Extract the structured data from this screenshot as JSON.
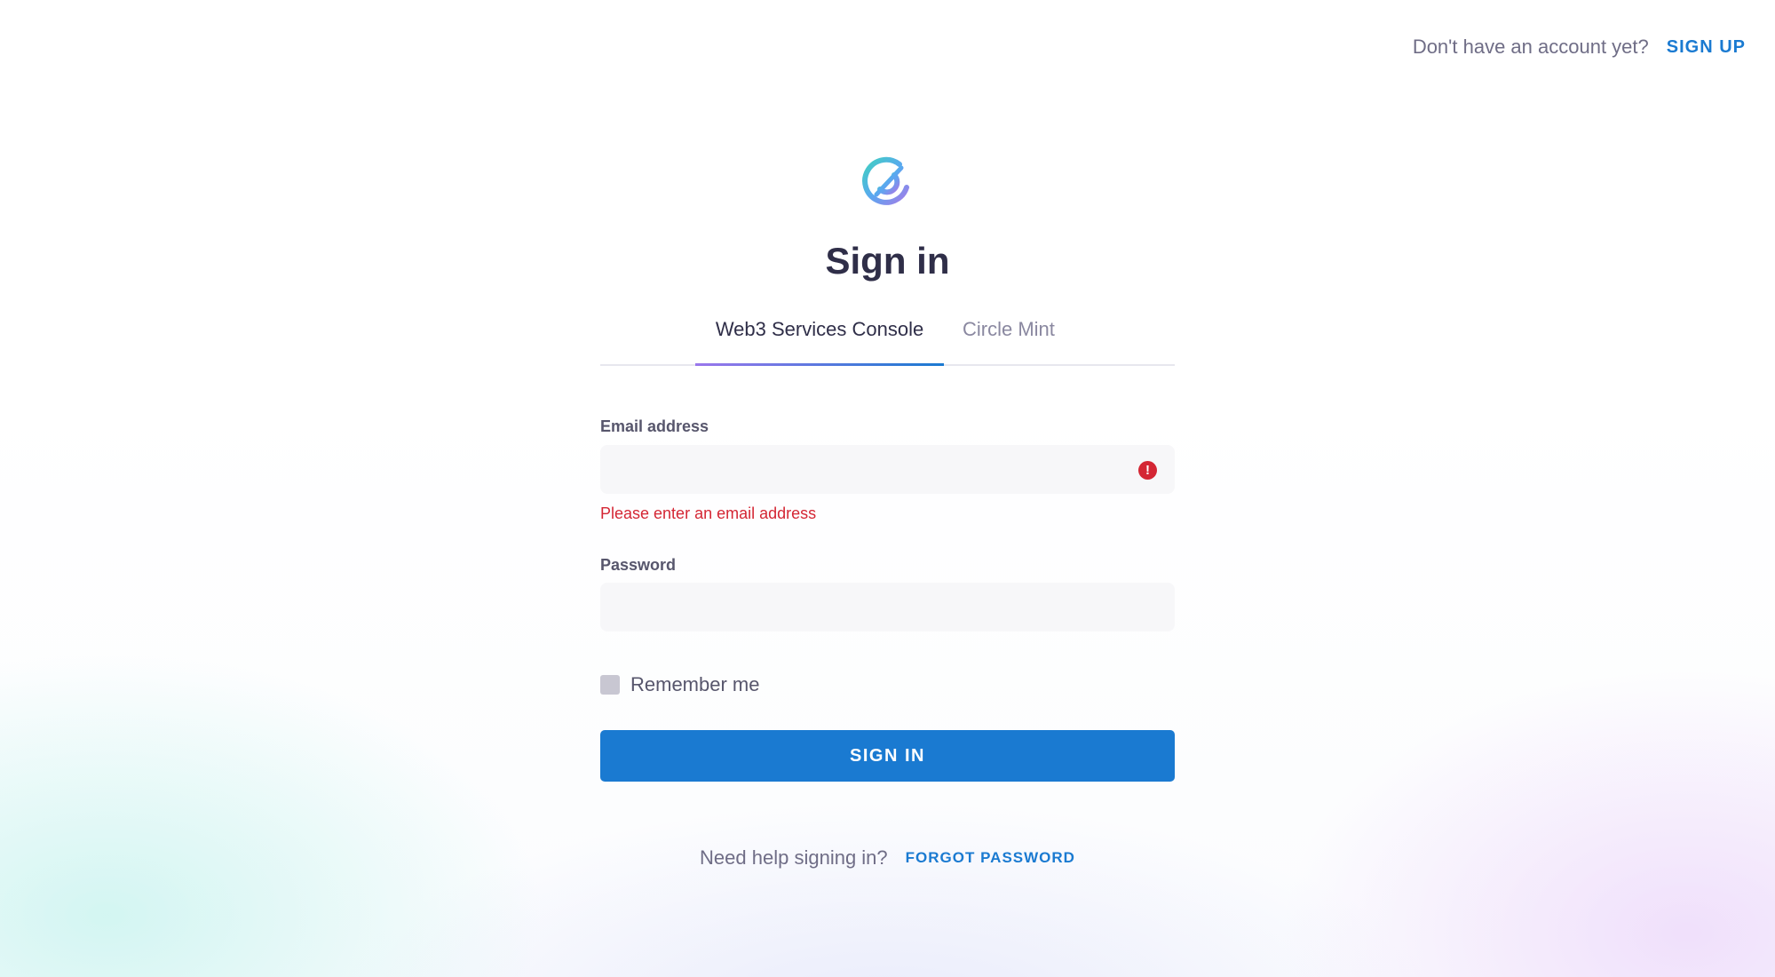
{
  "header": {
    "account_question": "Don't have an account yet?",
    "signup_label": "SIGN UP"
  },
  "logo": {
    "icon": "circle-logo-icon",
    "colors": [
      "#3fd0c0",
      "#5aa8f0",
      "#a27ce8"
    ]
  },
  "page_title": "Sign in",
  "tabs": [
    {
      "label": "Web3 Services Console",
      "active": true
    },
    {
      "label": "Circle Mint",
      "active": false
    }
  ],
  "form": {
    "email": {
      "label": "Email address",
      "value": "",
      "placeholder": "",
      "error": "Please enter an email address",
      "error_icon": "error-exclamation-icon"
    },
    "password": {
      "label": "Password",
      "value": "",
      "placeholder": ""
    },
    "remember_me": {
      "label": "Remember me",
      "checked": false
    },
    "submit_label": "SIGN IN"
  },
  "help": {
    "question": "Need help signing in?",
    "forgot_label": "FORGOT PASSWORD"
  },
  "colors": {
    "accent": "#1a7ad1",
    "error": "#d42634",
    "text": "#2f2e48",
    "muted": "#6f6d86"
  }
}
